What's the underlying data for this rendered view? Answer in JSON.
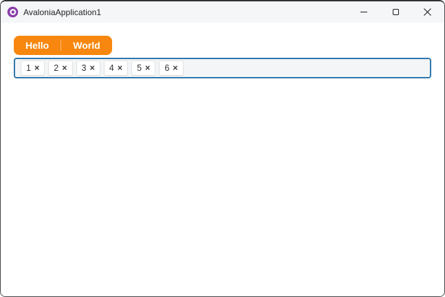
{
  "window": {
    "title": "AvaloniaApplication1"
  },
  "titlebar": {
    "icons": [
      "avalonia-logo-icon",
      "minimize-icon",
      "maximize-icon",
      "close-icon"
    ]
  },
  "tabs": [
    {
      "label": "Hello"
    },
    {
      "label": "World"
    }
  ],
  "chipbox": {
    "chips": [
      {
        "label": "1",
        "close_glyph": "×"
      },
      {
        "label": "2",
        "close_glyph": "×"
      },
      {
        "label": "3",
        "close_glyph": "×"
      },
      {
        "label": "4",
        "close_glyph": "×"
      },
      {
        "label": "5",
        "close_glyph": "×"
      },
      {
        "label": "6",
        "close_glyph": "×"
      }
    ]
  },
  "colors": {
    "accent_orange": "#F7870E",
    "focus_border_blue": "#2E76AC",
    "brand_purple": "#8B3FA9",
    "titlebar_bg": "#F4F6F8",
    "chipbox_bg": "#F4F5F7"
  }
}
